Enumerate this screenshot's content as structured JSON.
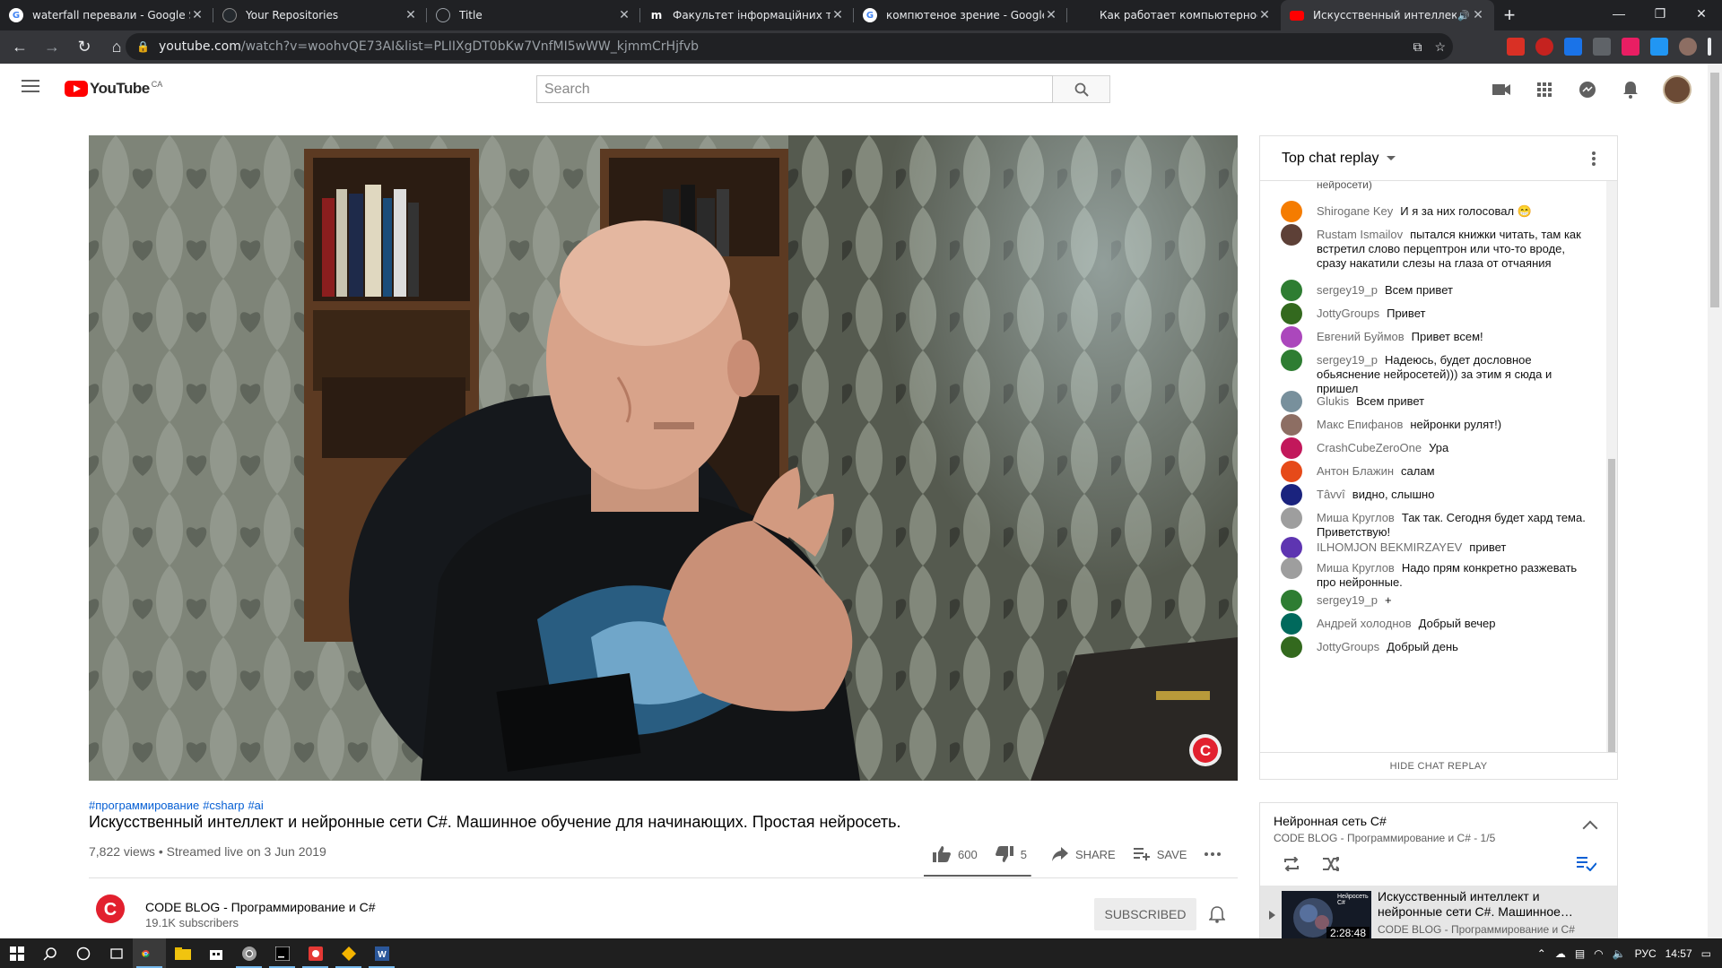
{
  "browser": {
    "tabs": [
      {
        "title": "waterfall перевали - Google Search",
        "favicon": "google-icon",
        "active": false
      },
      {
        "title": "Your Repositories",
        "favicon": "github-icon",
        "active": false
      },
      {
        "title": "Title",
        "favicon": "globe-icon",
        "active": false
      },
      {
        "title": "Факультет інформаційних технологій",
        "favicon": "m-icon",
        "active": false
      },
      {
        "title": "компютеное зрение - Google Search",
        "favicon": "google-icon",
        "active": false
      },
      {
        "title": "Как работает компьютерное зрение",
        "favicon": "none",
        "active": false
      },
      {
        "title": "Искусственный интеллект и",
        "favicon": "youtube-icon",
        "active": true
      }
    ],
    "url_host": "youtube.com",
    "url_path": "/watch?v=woohvQE73AI&list=PLIIXgDT0bKw7VnfMI5wWW_kjmmCrHjfvb"
  },
  "youtube": {
    "logo_text": "YouTube",
    "country_code": "CA",
    "search_placeholder": "Search"
  },
  "video": {
    "hashtags": [
      "#программирование",
      "#csharp",
      "#ai"
    ],
    "title": "Искусственный интеллект и нейронные сети C#. Машинное обучение для начинающих. Простая нейросеть.",
    "meta": "7,822 views • Streamed live on 3 Jun 2019",
    "likes": "600",
    "dislikes": "5",
    "share_label": "SHARE",
    "save_label": "SAVE",
    "like_ratio": 0.99
  },
  "channel": {
    "name": "CODE BLOG - Программирование и C#",
    "subs": "19.1K subscribers",
    "subscribed_label": "SUBSCRIBED"
  },
  "chat": {
    "header": "Top chat replay",
    "truncated_top": "нейросети)",
    "messages": [
      {
        "author": "Shirogane Key",
        "text": "И я за них голосовал 😁",
        "color": "#f57c00"
      },
      {
        "author": "Rustam Ismailov",
        "text": "пытался книжки читать, там как встретил слово перцептрон или что-то вроде, сразу накатили слезы на глаза от отчаяния",
        "color": "#5d4037"
      },
      {
        "author": "sergey19_p",
        "text": "Всем привет",
        "color": "#2e7d32"
      },
      {
        "author": "JottyGroups",
        "text": "Привет",
        "color": "#33691e"
      },
      {
        "author": "Евгений Буймов",
        "text": "Привет всем!",
        "color": "#ab47bc"
      },
      {
        "author": "sergey19_p",
        "text": "Надеюсь, будет дословное обьяснение нейросетей))) за этим я сюда и пришел",
        "color": "#2e7d32"
      },
      {
        "author": "Glukis",
        "text": "Всем привет",
        "color": "#78909c"
      },
      {
        "author": "Макс Епифанов",
        "text": "нейронки рулят!)",
        "color": "#8d6e63"
      },
      {
        "author": "CrashCubeZeroOne",
        "text": "Ура",
        "color": "#c2185b"
      },
      {
        "author": "Антон Блажин",
        "text": "салам",
        "color": "#e64a19"
      },
      {
        "author": "Tâvvî",
        "text": "видно, слышно",
        "color": "#1a237e"
      },
      {
        "author": "Миша Круглов",
        "text": "Так так. Сегодня будет хард тема. Приветствую!",
        "color": "#9e9e9e"
      },
      {
        "author": "ILHOMJON BEKMIRZAYEV",
        "text": "привет",
        "color": "#5e35b1"
      },
      {
        "author": "Миша Круглов",
        "text": "Надо прям конкретно разжевать про нейронные.",
        "color": "#9e9e9e"
      },
      {
        "author": "sergey19_p",
        "text": "+",
        "color": "#2e7d32"
      },
      {
        "author": "Андрей холоднов",
        "text": "Добрый вечер",
        "color": "#00695c"
      },
      {
        "author": "JottyGroups",
        "text": "Добрый день",
        "color": "#33691e"
      }
    ],
    "hide_label": "HIDE CHAT REPLAY"
  },
  "playlist": {
    "title": "Нейронная сеть C#",
    "subtitle": "CODE BLOG - Программирование и C# - 1/5",
    "item_title": "Искусственный интеллект и нейронные сети C#. Машинное…",
    "item_channel": "CODE BLOG - Программирование и C#",
    "item_duration": "2:28:48",
    "thumb_caption": "Нейросеть C#"
  },
  "system": {
    "lang": "РУС",
    "time": "14:57"
  }
}
